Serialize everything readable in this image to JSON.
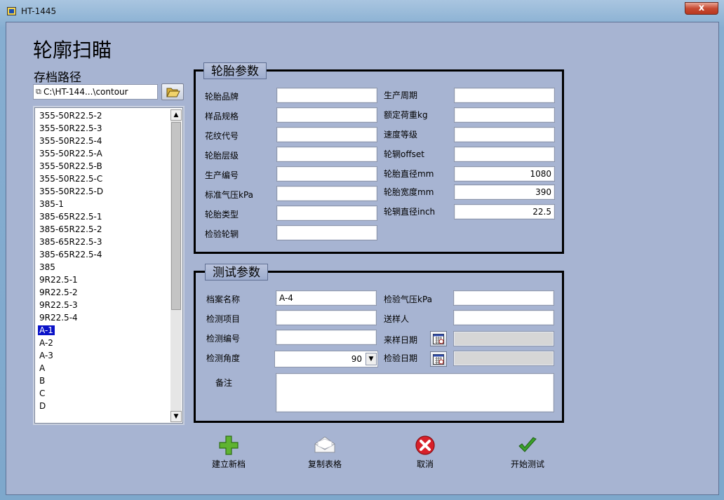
{
  "window": {
    "title": "HT-1445",
    "close": "x"
  },
  "page_title": "轮廓扫瞄",
  "archive": {
    "label": "存档路径",
    "path": "C:\\HT-144...\\contour"
  },
  "list": {
    "items": [
      "355-50R22.5-2",
      "355-50R22.5-3",
      "355-50R22.5-4",
      "355-50R22.5-A",
      "355-50R22.5-B",
      "355-50R22.5-C",
      "355-50R22.5-D",
      "385-1",
      "385-65R22.5-1",
      "385-65R22.5-2",
      "385-65R22.5-3",
      "385-65R22.5-4",
      "385",
      "9R22.5-1",
      "9R22.5-2",
      "9R22.5-3",
      "9R22.5-4",
      "A-1",
      "A-2",
      "A-3",
      "A",
      "B",
      "C",
      "D"
    ],
    "selected": "A-1"
  },
  "tire_params": {
    "title": "轮胎参数",
    "left": [
      {
        "label": "轮胎品牌",
        "value": ""
      },
      {
        "label": "样品规格",
        "value": ""
      },
      {
        "label": "花纹代号",
        "value": ""
      },
      {
        "label": "轮胎层级",
        "value": ""
      },
      {
        "label": "生产编号",
        "value": ""
      },
      {
        "label": "标准气压kPa",
        "value": ""
      },
      {
        "label": "轮胎类型",
        "value": ""
      },
      {
        "label": "检验轮辋",
        "value": ""
      }
    ],
    "right": [
      {
        "label": "生产周期",
        "value": ""
      },
      {
        "label": "额定荷重kg",
        "value": ""
      },
      {
        "label": "速度等级",
        "value": ""
      },
      {
        "label": "轮辋offset",
        "value": ""
      },
      {
        "label": "轮胎直径mm",
        "value": "1080"
      },
      {
        "label": "轮胎宽度mm",
        "value": "390"
      },
      {
        "label": "轮辋直径inch",
        "value": "22.5"
      }
    ]
  },
  "test_params": {
    "title": "测试参数",
    "file_name_label": "档案名称",
    "file_name": "A-4",
    "test_item_label": "检测项目",
    "test_item": "",
    "test_no_label": "检测编号",
    "test_no": "",
    "angle_label": "检测角度",
    "angle": "90",
    "pressure_label": "检验气压kPa",
    "pressure": "",
    "sender_label": "送样人",
    "sender": "",
    "sample_date_label": "来样日期",
    "sample_date": "",
    "test_date_label": "检验日期",
    "test_date": "",
    "remark_label": "备注",
    "remark": ""
  },
  "actions": {
    "new": "建立新档",
    "copy": "复制表格",
    "cancel": "取消",
    "start": "开始测试"
  },
  "colors": {
    "selection": "#0a12c8",
    "group_border": "#000000",
    "cancel_red": "#d8202a",
    "ok_green": "#3aa12a"
  }
}
